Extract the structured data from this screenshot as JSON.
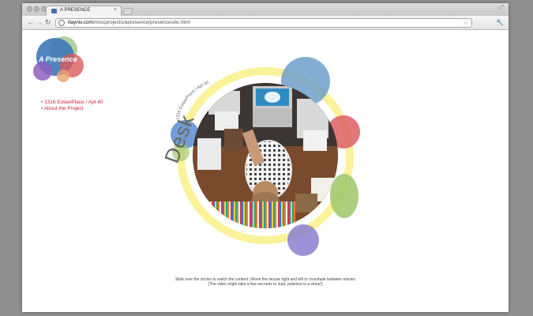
{
  "browser": {
    "tab_title": "A PRESENCE",
    "tab_close": "×",
    "url_host": "itayniv.com",
    "url_path": "/miscprojects/apresence/presencesite.html",
    "back_icon": "arrow-left-icon",
    "forward_icon": "arrow-right-icon",
    "reload_icon": "reload-icon",
    "star_icon": "star-icon",
    "wrench_icon": "wrench-icon"
  },
  "logo": {
    "text": "A Presence"
  },
  "nav": {
    "items": [
      {
        "label": "• 1316 EutawPlace / Apt 40"
      },
      {
        "label": "• About the Project"
      }
    ]
  },
  "stage": {
    "section_label": "Desk",
    "arc_label": "1316 EutawPlace / Apt 40"
  },
  "footer": {
    "line1": "Slide over the circles to watch the content | Move the mouse right and left to crossfade between movies",
    "line2": "(The video might take a few seconds to load, patience is a virtue!)"
  },
  "colors": {
    "page_bg": "#8f8f8f",
    "nav_link": "#d0233a",
    "ring": "#fbf29a",
    "circle_blue": "#6fa0c9",
    "circle_red": "#e0676a",
    "circle_green": "#a3c96f",
    "circle_purple": "#8b7fd1"
  }
}
